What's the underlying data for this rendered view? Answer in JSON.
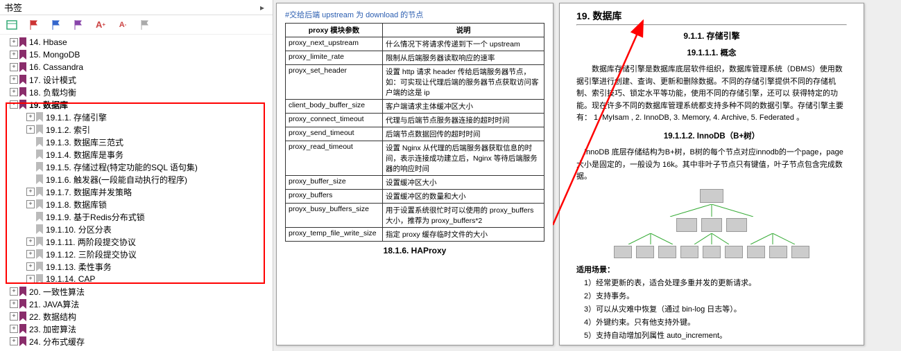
{
  "sidebar": {
    "title": "书签",
    "toolbar_icons": [
      "panel",
      "flag-red",
      "flag-blue",
      "flag-purple",
      "font-plus",
      "font-minus",
      "flag-grey"
    ],
    "top_level": [
      {
        "label": "14. Hbase",
        "exp": "+",
        "indent": 12
      },
      {
        "label": "15. MongoDB",
        "exp": "+",
        "indent": 12
      },
      {
        "label": "16. Cassandra",
        "exp": "+",
        "indent": 12
      },
      {
        "label": "17. 设计模式",
        "exp": "+",
        "indent": 12
      },
      {
        "label": "18. 负载均衡",
        "exp": "+",
        "indent": 12
      },
      {
        "label": "19. 数据库",
        "exp": "-",
        "indent": 12,
        "sel": true
      },
      {
        "label": "19.1.1. 存储引擎",
        "exp": "+",
        "indent": 36,
        "grey": true
      },
      {
        "label": "19.1.2. 索引",
        "exp": "+",
        "indent": 36,
        "grey": true
      },
      {
        "label": "19.1.3. 数据库三范式",
        "exp": "",
        "indent": 36,
        "grey": true
      },
      {
        "label": "19.1.4. 数据库是事务",
        "exp": "",
        "indent": 36,
        "grey": true
      },
      {
        "label": "19.1.5. 存储过程(特定功能的SQL 语句集)",
        "exp": "",
        "indent": 36,
        "grey": true
      },
      {
        "label": "19.1.6. 触发器(一段能自动执行的程序)",
        "exp": "",
        "indent": 36,
        "grey": true
      },
      {
        "label": "19.1.7. 数据库并发策略",
        "exp": "+",
        "indent": 36,
        "grey": true
      },
      {
        "label": "19.1.8. 数据库锁",
        "exp": "+",
        "indent": 36,
        "grey": true
      },
      {
        "label": "19.1.9. 基于Redis分布式锁",
        "exp": "",
        "indent": 36,
        "grey": true
      },
      {
        "label": "19.1.10. 分区分表",
        "exp": "",
        "indent": 36,
        "grey": true
      },
      {
        "label": "19.1.11. 两阶段提交协议",
        "exp": "+",
        "indent": 36,
        "grey": true
      },
      {
        "label": "19.1.12. 三阶段提交协议",
        "exp": "+",
        "indent": 36,
        "grey": true
      },
      {
        "label": "19.1.13. 柔性事务",
        "exp": "+",
        "indent": 36,
        "grey": true
      },
      {
        "label": "19.1.14. CAP",
        "exp": "+",
        "indent": 36,
        "grey": true
      },
      {
        "label": "20. 一致性算法",
        "exp": "+",
        "indent": 12
      },
      {
        "label": "21. JAVA算法",
        "exp": "+",
        "indent": 12
      },
      {
        "label": "22. 数据结构",
        "exp": "+",
        "indent": 12
      },
      {
        "label": "23. 加密算法",
        "exp": "+",
        "indent": 12
      },
      {
        "label": "24. 分布式缓存",
        "exp": "+",
        "indent": 12
      }
    ]
  },
  "page1": {
    "link_text": "#交给后端 upstream 为 download 的节点",
    "th1": "proxy 模块参数",
    "th2": "说明",
    "rows": [
      {
        "k": "proxy_next_upstream",
        "v": "什么情况下将请求传递到下一个 upstream"
      },
      {
        "k": "proxy_limite_rate",
        "v": "限制从后端服务器读取响应的速率"
      },
      {
        "k": "proyx_set_header",
        "v": "设置 http 请求 header 传给后端服务器节点，如：可实现让代理后端的服务器节点获取访问客户端的这是 ip"
      },
      {
        "k": "client_body_buffer_size",
        "v": "客户端请求主体缓冲区大小"
      },
      {
        "k": "proxy_connect_timeout",
        "v": "代理与后端节点服务器连接的超时时间"
      },
      {
        "k": "proxy_send_timeout",
        "v": "后端节点数据回传的超时时间"
      },
      {
        "k": "proxy_read_timeout",
        "v": "设置 Nginx 从代理的后端服务器获取信息的时间，表示连接成功建立后，Nginx 等待后端服务器的响应时间"
      },
      {
        "k": "proxy_buffer_size",
        "v": "设置缓冲区大小"
      },
      {
        "k": "proxy_buffers",
        "v": "设置缓冲区的数量和大小"
      },
      {
        "k": "proyx_busy_buffers_size",
        "v": "用于设置系统很忙时可以使用的 proxy_buffers 大小，推荐为 proxy_buffers*2"
      },
      {
        "k": "proxy_temp_file_write_size",
        "v": "指定 proxy 缓存临时文件的大小"
      }
    ],
    "section": "18.1.6.    HAProxy"
  },
  "page2": {
    "title": "19.    数据库",
    "h2": "9.1.1.    存储引擎",
    "h3a": "19.1.1.1.    概念",
    "para": "数据库存储引擎是数据库底层软件组织，数据库管理系统（DBMS）使用数据引擎进行创建、查询、更新和删除数据。不同的存储引擎提供不同的存储机制、索引技巧、锁定水平等功能，使用不同的存储引擎，还可以 获得特定的功能。现在许多不同的数据库管理系统都支持多种不同的数据引擎。存储引擎主要有： 1. MyIsam , 2. InnoDB, 3. Memory, 4. Archive, 5. Federated 。",
    "h3b": "19.1.1.2.    InnoDB（B+树）",
    "para2": "InnoDB 底层存储结构为B+树，B树的每个节点对应innodb的一个page，page大小是固定的，一般设为 16k。其中非叶子节点只有键值，叶子节点包含完成数据。",
    "scene_title": "适用场景：",
    "scenes": [
      "1）经常更新的表，适合处理多重并发的更新请求。",
      "2）支持事务。",
      "3）可以从灾难中恢复（通过 bin-log 日志等）。",
      "4）外键约束。只有他支持外键。",
      "5）支持自动增加列属性 auto_increment。"
    ]
  }
}
